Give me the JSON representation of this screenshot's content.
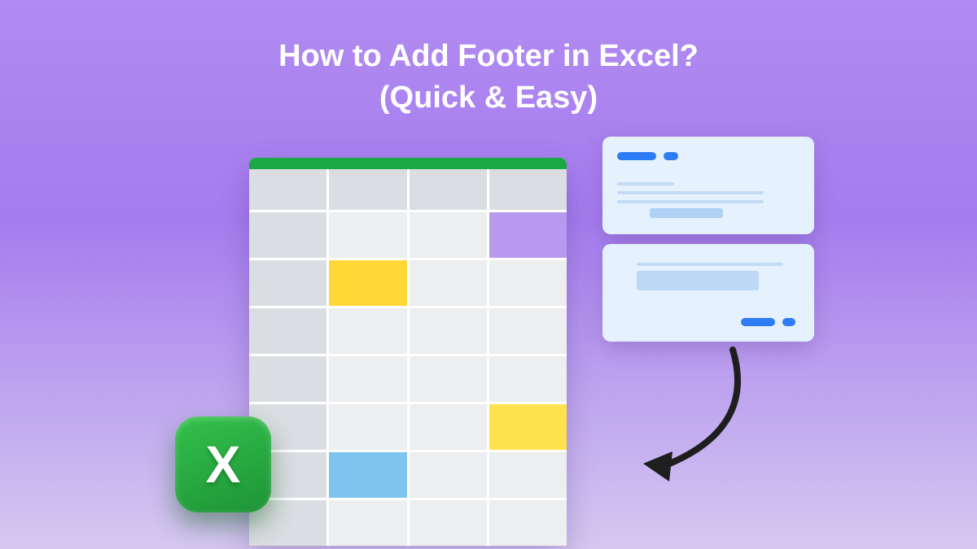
{
  "title": {
    "line1": "How to Add Footer in Excel?",
    "line2": "(Quick & Easy)"
  },
  "excel_icon_letter": "X",
  "colors": {
    "background_start": "#b18bf1",
    "background_end": "#d5c8f0",
    "excel_green": "#1aa944",
    "accent_blue": "#2e7cf6",
    "cell_yellow": "#ffd736",
    "cell_purple": "#b79af0",
    "cell_blue": "#7dc5ef"
  },
  "icons": {
    "excel_badge": "excel-app-icon",
    "arrow": "curved-arrow-icon"
  }
}
